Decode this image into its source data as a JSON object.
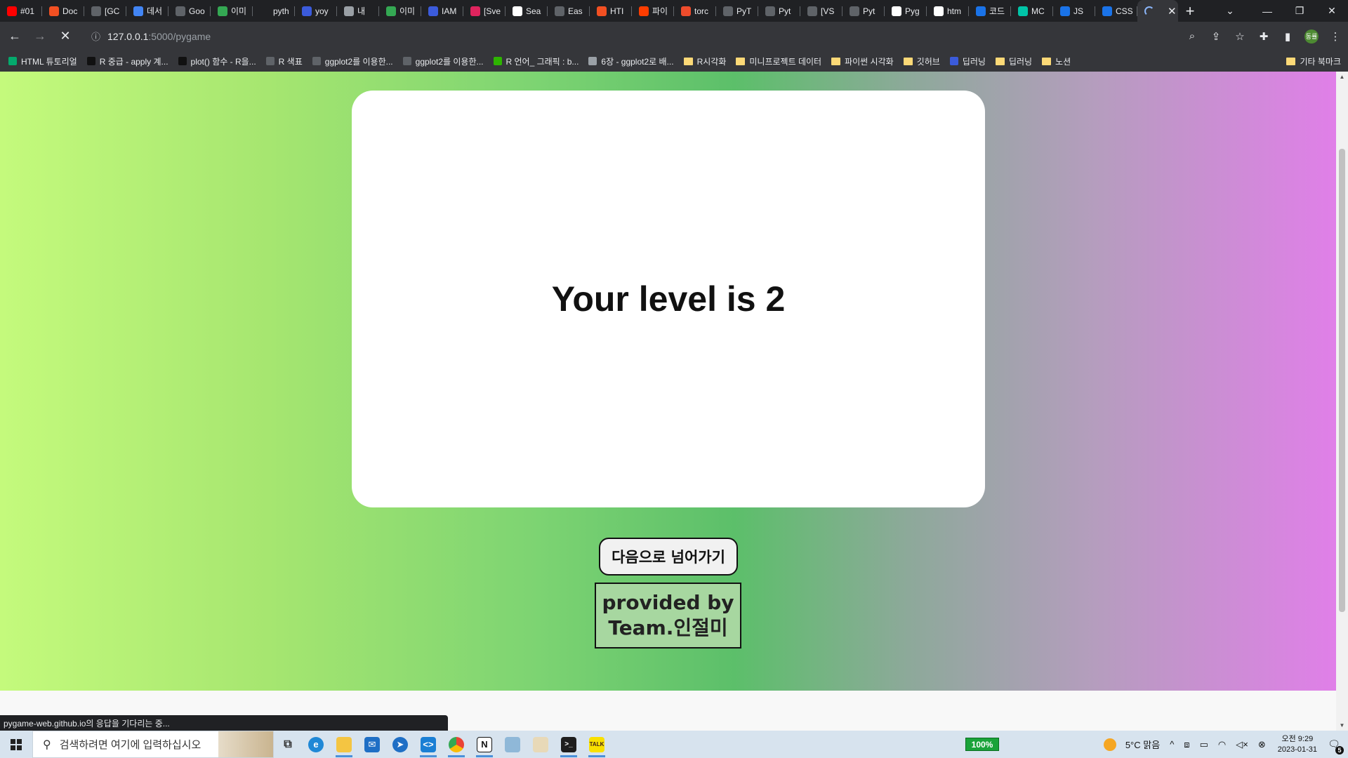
{
  "browser": {
    "tabs": [
      {
        "title": "#01",
        "color": "#ff0000"
      },
      {
        "title": "Doc",
        "color": "#f25022"
      },
      {
        "title": "[GC",
        "color": "#5f6368"
      },
      {
        "title": "데서",
        "color": "#4285f4"
      },
      {
        "title": "Goo",
        "color": "#5f6368"
      },
      {
        "title": "이미",
        "color": "#34a853"
      },
      {
        "title": "pyth",
        "color": "#202124"
      },
      {
        "title": "yoy",
        "color": "#3b5bdb"
      },
      {
        "title": "내",
        "color": "#9aa0a6"
      },
      {
        "title": "이미",
        "color": "#34a853"
      },
      {
        "title": "IAM",
        "color": "#3b5bdb"
      },
      {
        "title": "[Sve",
        "color": "#e0245e"
      },
      {
        "title": "Sea",
        "color": "#ffffff"
      },
      {
        "title": "Eas",
        "color": "#5f6368"
      },
      {
        "title": "HTI",
        "color": "#f25022"
      },
      {
        "title": "파이",
        "color": "#ff3d00"
      },
      {
        "title": "torc",
        "color": "#ee4c2c"
      },
      {
        "title": "PyT",
        "color": "#5f6368"
      },
      {
        "title": "Pyt",
        "color": "#5f6368"
      },
      {
        "title": "[VS",
        "color": "#5f6368"
      },
      {
        "title": "Pyt",
        "color": "#5f6368"
      },
      {
        "title": "Pyg",
        "color": "#ffffff"
      },
      {
        "title": "htm",
        "color": "#ffffff"
      },
      {
        "title": "코드",
        "color": "#1a73e8"
      },
      {
        "title": "MC",
        "color": "#00c4a7"
      },
      {
        "title": "JS",
        "color": "#1a73e8"
      },
      {
        "title": "CSS",
        "color": "#1a73e8"
      }
    ],
    "active_tab_close": "✕",
    "new_tab": "+",
    "url_host": "127.0.0.1",
    "url_path": ":5000/pygame",
    "bookmarks": [
      {
        "label": "HTML 튜토리얼",
        "color": "#04aa6d"
      },
      {
        "label": "R 중급 - apply 계...",
        "color": "#111111"
      },
      {
        "label": "plot() 함수 - R을...",
        "color": "#111111"
      },
      {
        "label": "R 색표",
        "color": "#5f6368"
      },
      {
        "label": "ggplot2를 이용한...",
        "color": "#5f6368"
      },
      {
        "label": "ggplot2를 이용한...",
        "color": "#5f6368"
      },
      {
        "label": "R 언어_ 그래픽 : b...",
        "color": "#2db400"
      },
      {
        "label": "6장 - ggplot2로 배...",
        "color": "#9aa0a6"
      },
      {
        "label": "R시각화",
        "folder": true
      },
      {
        "label": "미니프로젝트 데이터",
        "folder": true
      },
      {
        "label": "파이썬 시각화",
        "folder": true
      },
      {
        "label": "깃허브",
        "folder": true
      },
      {
        "label": "딥러닝",
        "color": "#3b5bdb"
      },
      {
        "label": "딥러닝",
        "folder": true
      },
      {
        "label": "노션",
        "folder": true
      }
    ],
    "other_bookmarks": "기타 북마크",
    "avatar": "동률"
  },
  "page": {
    "heading": "Your level is 2",
    "next_button": "다음으로 넘어가기",
    "credit_line1": "provided by",
    "credit_line2": "Team.인절미",
    "status_text": "pygame-web.github.io의 응답을 기다리는 중..."
  },
  "taskbar": {
    "search_placeholder": "검색하려면 여기에 입력하십시오",
    "battery_badge": "100%",
    "weather": "5°C  맑음",
    "time": "오전 9:29",
    "date": "2023-01-31",
    "notifications": "5"
  }
}
